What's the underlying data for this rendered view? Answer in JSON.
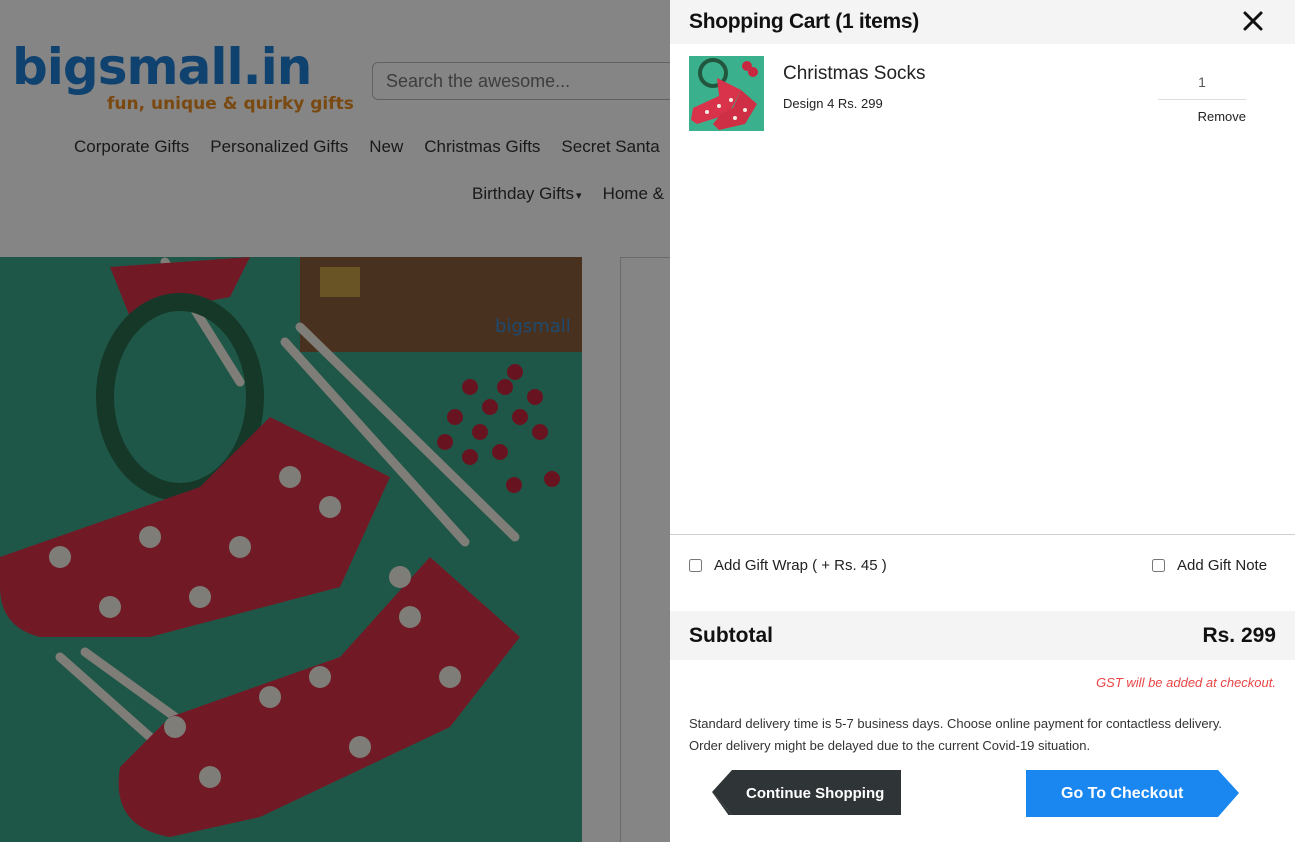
{
  "site": {
    "logo_main": "bigsmall.in",
    "logo_tagline": "fun, unique & quirky gifts",
    "search_placeholder": "Search the awesome...",
    "nav": [
      "Corporate Gifts",
      "Personalized Gifts",
      "New",
      "Christmas Gifts",
      "Secret Santa"
    ],
    "nav2": [
      {
        "label": "Birthday Gifts",
        "caret": "▾"
      },
      {
        "label": "Home &"
      }
    ],
    "image_watermark": "bigsmall"
  },
  "cart": {
    "title": "Shopping Cart (1 items)",
    "close_icon": "close-icon",
    "items": [
      {
        "name": "Christmas Socks",
        "variant": "Design 4 Rs. 299",
        "quantity": "1",
        "remove_label": "Remove"
      }
    ],
    "gift_wrap_label": "Add Gift Wrap ( + Rs. 45 )",
    "gift_note_label": "Add Gift Note",
    "gift_wrap_checked": false,
    "gift_note_checked": false,
    "subtotal_label": "Subtotal",
    "subtotal_value": "Rs. 299",
    "gst_note": "GST will be added at checkout.",
    "delivery_line1": "Standard delivery time is 5-7 business days. Choose online payment for contactless delivery.",
    "delivery_line2": "Order delivery might be delayed due to the current Covid-19 situation.",
    "continue_label": "Continue Shopping",
    "checkout_label": "Go To Checkout"
  },
  "colors": {
    "brand_blue": "#1f7fd6",
    "brand_orange": "#e98c22",
    "checkout_blue": "#1a86f0",
    "continue_dark": "#2f3437",
    "gst_red": "#e84545",
    "overlay": "rgba(0,0,0,0.48)"
  }
}
